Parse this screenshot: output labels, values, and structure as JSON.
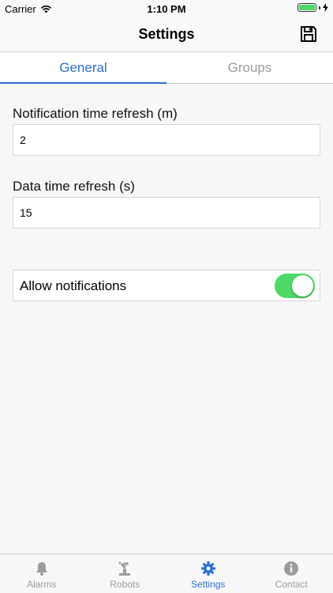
{
  "status_bar": {
    "carrier": "Carrier",
    "time": "1:10 PM"
  },
  "nav": {
    "title": "Settings"
  },
  "tabs": [
    {
      "label": "General",
      "active": true
    },
    {
      "label": "Groups",
      "active": false
    }
  ],
  "form": {
    "notification_refresh": {
      "label": "Notification time refresh (m)",
      "value": "2"
    },
    "data_refresh": {
      "label": "Data time refresh (s)",
      "value": "15"
    },
    "allow_notifications": {
      "label": "Allow notifications",
      "enabled": true
    }
  },
  "tab_bar": {
    "items": [
      {
        "label": "Alarms",
        "icon": "bell-icon"
      },
      {
        "label": "Robots",
        "icon": "robot-icon"
      },
      {
        "label": "Settings",
        "icon": "gear-icon",
        "active": true
      },
      {
        "label": "Contact",
        "icon": "info-icon"
      }
    ]
  },
  "colors": {
    "accent": "#2c6fd1",
    "toggle_on": "#4cd964",
    "inactive": "#9b9b9b"
  }
}
